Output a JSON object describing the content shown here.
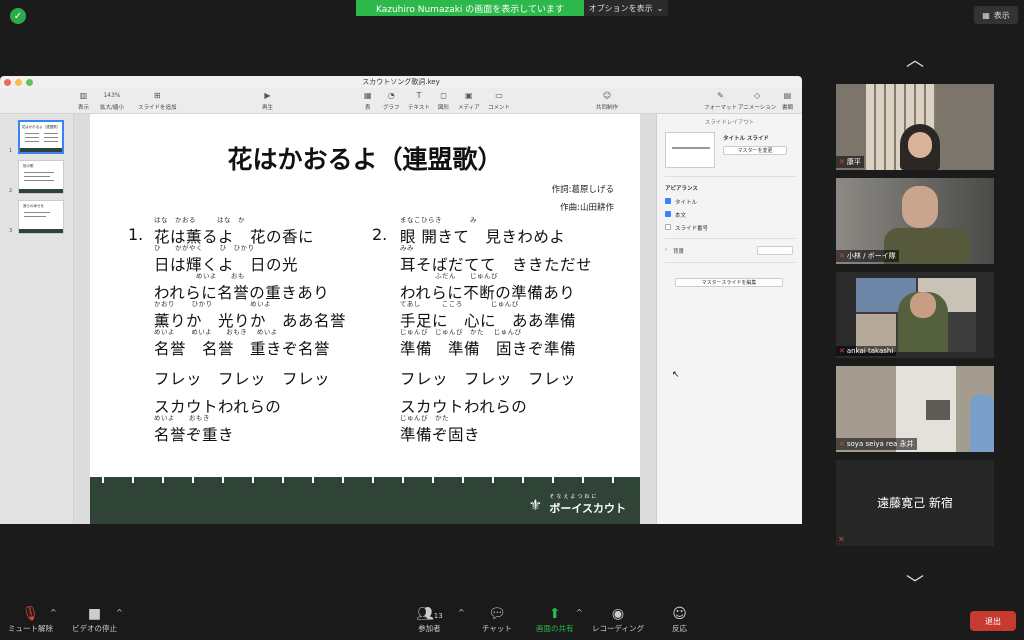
{
  "topbar": {
    "share_banner": "Kazuhiro Numazaki の画面を表示しています",
    "options_label": "オプションを表示",
    "view_label": "表示"
  },
  "keynote": {
    "window_title": "スカウトソング歌詞.key",
    "toolbar": {
      "view": "表示",
      "zoom_value": "143%",
      "zoom_label": "拡大/縮小",
      "add_slide": "スライドを追加",
      "play": "再生",
      "table": "表",
      "chart": "グラフ",
      "text": "テキスト",
      "shape": "図形",
      "media": "メディア",
      "comment": "コメント",
      "collaborate": "共同制作",
      "format": "フォーマット",
      "animate": "アニメーション",
      "document": "書類"
    },
    "navigator": {
      "slide_numbers": [
        "1",
        "2",
        "3"
      ],
      "thumb_titles": [
        "花はかおるよ（連盟歌）",
        "班の歌",
        "我らの幸せを"
      ]
    },
    "slide": {
      "title": "花はかおるよ（連盟歌）",
      "lyricist": "作詞:葛原しげる",
      "composer": "作曲:山田耕作",
      "verse1": {
        "number": "1.",
        "lines": [
          {
            "ruby": "はな　かおる　　　はな　か",
            "text": "花は薫るよ　花の香に"
          },
          {
            "ruby": "ひ　　かがやく　　 ひ　ひかり",
            "text": "日は輝くよ　日の光"
          },
          {
            "ruby": "　　　　　　めいよ　　おも",
            "text": "われらに名誉の重きあり"
          },
          {
            "ruby": "かおり　　 ひかり　　　　　 めいよ",
            "text": "薫りか　光りか　ああ名誉"
          },
          {
            "ruby": "めいよ　　 めいよ　　おもき　 めいよ",
            "text": "名誉　名誉　重きぞ名誉"
          },
          {
            "ruby": "",
            "text": "フレッ　フレッ　フレッ"
          },
          {
            "ruby": "",
            "text": "スカウトわれらの"
          },
          {
            "ruby": "めいよ　　おもき",
            "text": "名誉ぞ重き"
          }
        ]
      },
      "verse2": {
        "number": "2.",
        "lines": [
          {
            "ruby": "まなこひらき　　　　み",
            "text": "眼 開きて　見きわめよ"
          },
          {
            "ruby": "みみ",
            "text": "耳そばだてて　ききただせ"
          },
          {
            "ruby": "　　　　　ふだん　　じゅんび",
            "text": "われらに不断の準備あり"
          },
          {
            "ruby": "てあし　　　こころ　　　　じゅんび",
            "text": "手足に　心に　ああ準備"
          },
          {
            "ruby": "じゅんび　じゅんび　かた　 じゅんび",
            "text": "準備　準備　固きぞ準備"
          },
          {
            "ruby": "",
            "text": "フレッ　フレッ　フレッ"
          },
          {
            "ruby": "",
            "text": "スカウトわれらの"
          },
          {
            "ruby": "じゅんび　かた",
            "text": "準備ぞ固き"
          }
        ]
      },
      "footer_logo_small": "そなえよつねに",
      "footer_logo": "ボーイスカウト"
    },
    "inspector": {
      "header": "スライドレイアウト",
      "layout_name": "タイトル スライド",
      "change_master": "マスターを変更",
      "appearance": "アピアランス",
      "title_check": "タイトル",
      "body_check": "本文",
      "slide_number_check": "スライド番号",
      "background": "背景",
      "edit_master": "マスタースライドを編集"
    }
  },
  "gallery": {
    "participants": [
      "康平",
      "小林 / ボーイ隊",
      "ankai takashi",
      "soya seiya rea 永井",
      "遠藤寛己 新宿"
    ]
  },
  "bottombar": {
    "unmute": "ミュート解除",
    "stop_video": "ビデオの停止",
    "participants": "参加者",
    "participant_count": "13",
    "chat": "チャット",
    "share_screen": "画面の共有",
    "record": "レコーディング",
    "reactions": "反応",
    "leave": "退出"
  },
  "colors": {
    "share_green": "#2db84b",
    "leave_red": "#c63a30",
    "scout_green": "#2f4436"
  }
}
